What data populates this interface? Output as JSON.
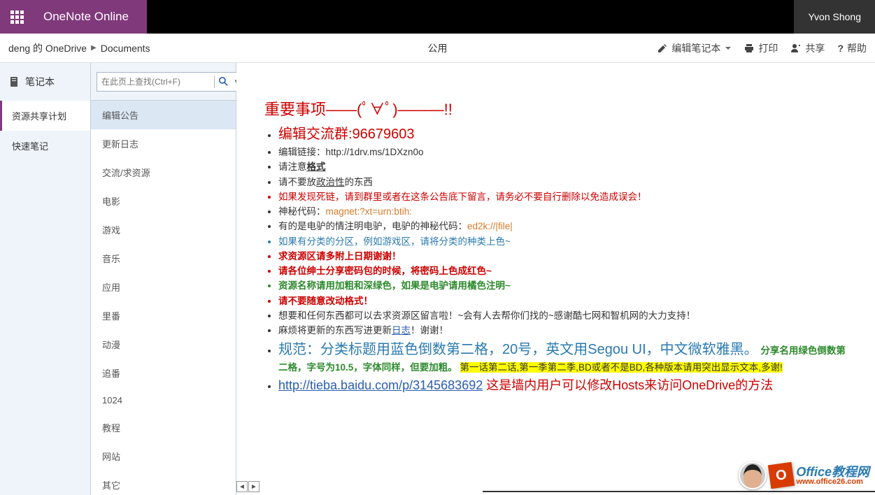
{
  "header": {
    "app_name": "OneNote Online",
    "user_name": "Yvon Shong"
  },
  "breadcrumb": {
    "root": "deng 的 OneDrive",
    "current": "Documents"
  },
  "cmdbar": {
    "center": "公用",
    "edit": "编辑笔记本",
    "print": "打印",
    "share": "共享",
    "help": "帮助"
  },
  "sidebar_left": {
    "notebook_label": "笔记本",
    "items": [
      {
        "label": "资源共享计划",
        "active": true
      },
      {
        "label": "快速笔记",
        "active": false
      }
    ]
  },
  "search": {
    "placeholder": "在此页上查找(Ctrl+F)"
  },
  "sections": [
    {
      "label": "编辑公告",
      "active": true
    },
    {
      "label": "更新日志",
      "active": false
    },
    {
      "label": "交流/求资源",
      "active": false
    },
    {
      "label": "电影",
      "active": false
    },
    {
      "label": "游戏",
      "active": false
    },
    {
      "label": "音乐",
      "active": false
    },
    {
      "label": "应用",
      "active": false
    },
    {
      "label": "里番",
      "active": false
    },
    {
      "label": "动漫",
      "active": false
    },
    {
      "label": "追番",
      "active": false
    },
    {
      "label": "1024",
      "active": false
    },
    {
      "label": "教程",
      "active": false
    },
    {
      "label": "网站",
      "active": false
    },
    {
      "label": "其它",
      "active": false
    }
  ],
  "note": {
    "title": "重要事项——(ﾟ∀ﾟ)———!!",
    "subtitle_prefix": "编辑交流群:",
    "subtitle_value": "96679603",
    "lines": {
      "l1a": "编辑链接：",
      "l1b": "http://1drv.ms/1DXzn0o",
      "l2a": "请注意",
      "l2b": "格式",
      "l3a": "请不要放",
      "l3b": "政治性",
      "l3c": "的东西",
      "l4": "如果发现死链，请到群里或者在这条公告底下留言，请务必不要自行删除以免造成误会！",
      "l5a": "神秘代码：",
      "l5b": "magnet:?xt=urn:btih:",
      "l6a": "有的是电驴的情注明电驴，电驴的神秘代码：",
      "l6b": "ed2k://|file|",
      "l7": "如果有分类的分区，例如游戏区，请将分类的种类上色~",
      "l8": "求资源区请多附上日期谢谢！",
      "l9": "请各位绅士分享密码包的时候，将密码上色成红色~",
      "l10": "资源名称请用加粗和深绿色，如果是电驴请用橘色注明~",
      "l11": "请不要随意改动格式！",
      "l12": "想要和任何东西都可以去求资源区留言啦！~会有人去帮你们找的~感谢酷七网和智机网的大力支持！",
      "l13a": "麻烦将更新的东西写进更新",
      "l13b": "日志",
      "l13c": "！谢谢！"
    },
    "spec": {
      "blue": "规范：分类标题用蓝色倒数第二格，20号，英文用Segou UI，中文微软雅黑。",
      "green": "分享名用绿色倒数第二格，字号为10.5，字体同样，但要加粗。",
      "hl": "第一话第二话,第一季第二季,BD或者不是BD,各种版本请用突出显示文本,多谢!"
    },
    "link": {
      "url": "http://tieba.baidu.com/p/3145683692",
      "desc": " 这是墙内用户可以修改Hosts来访问OneDrive的方法"
    }
  },
  "watermark": {
    "text1": "Office教程网",
    "text2": "www.office26.com"
  }
}
